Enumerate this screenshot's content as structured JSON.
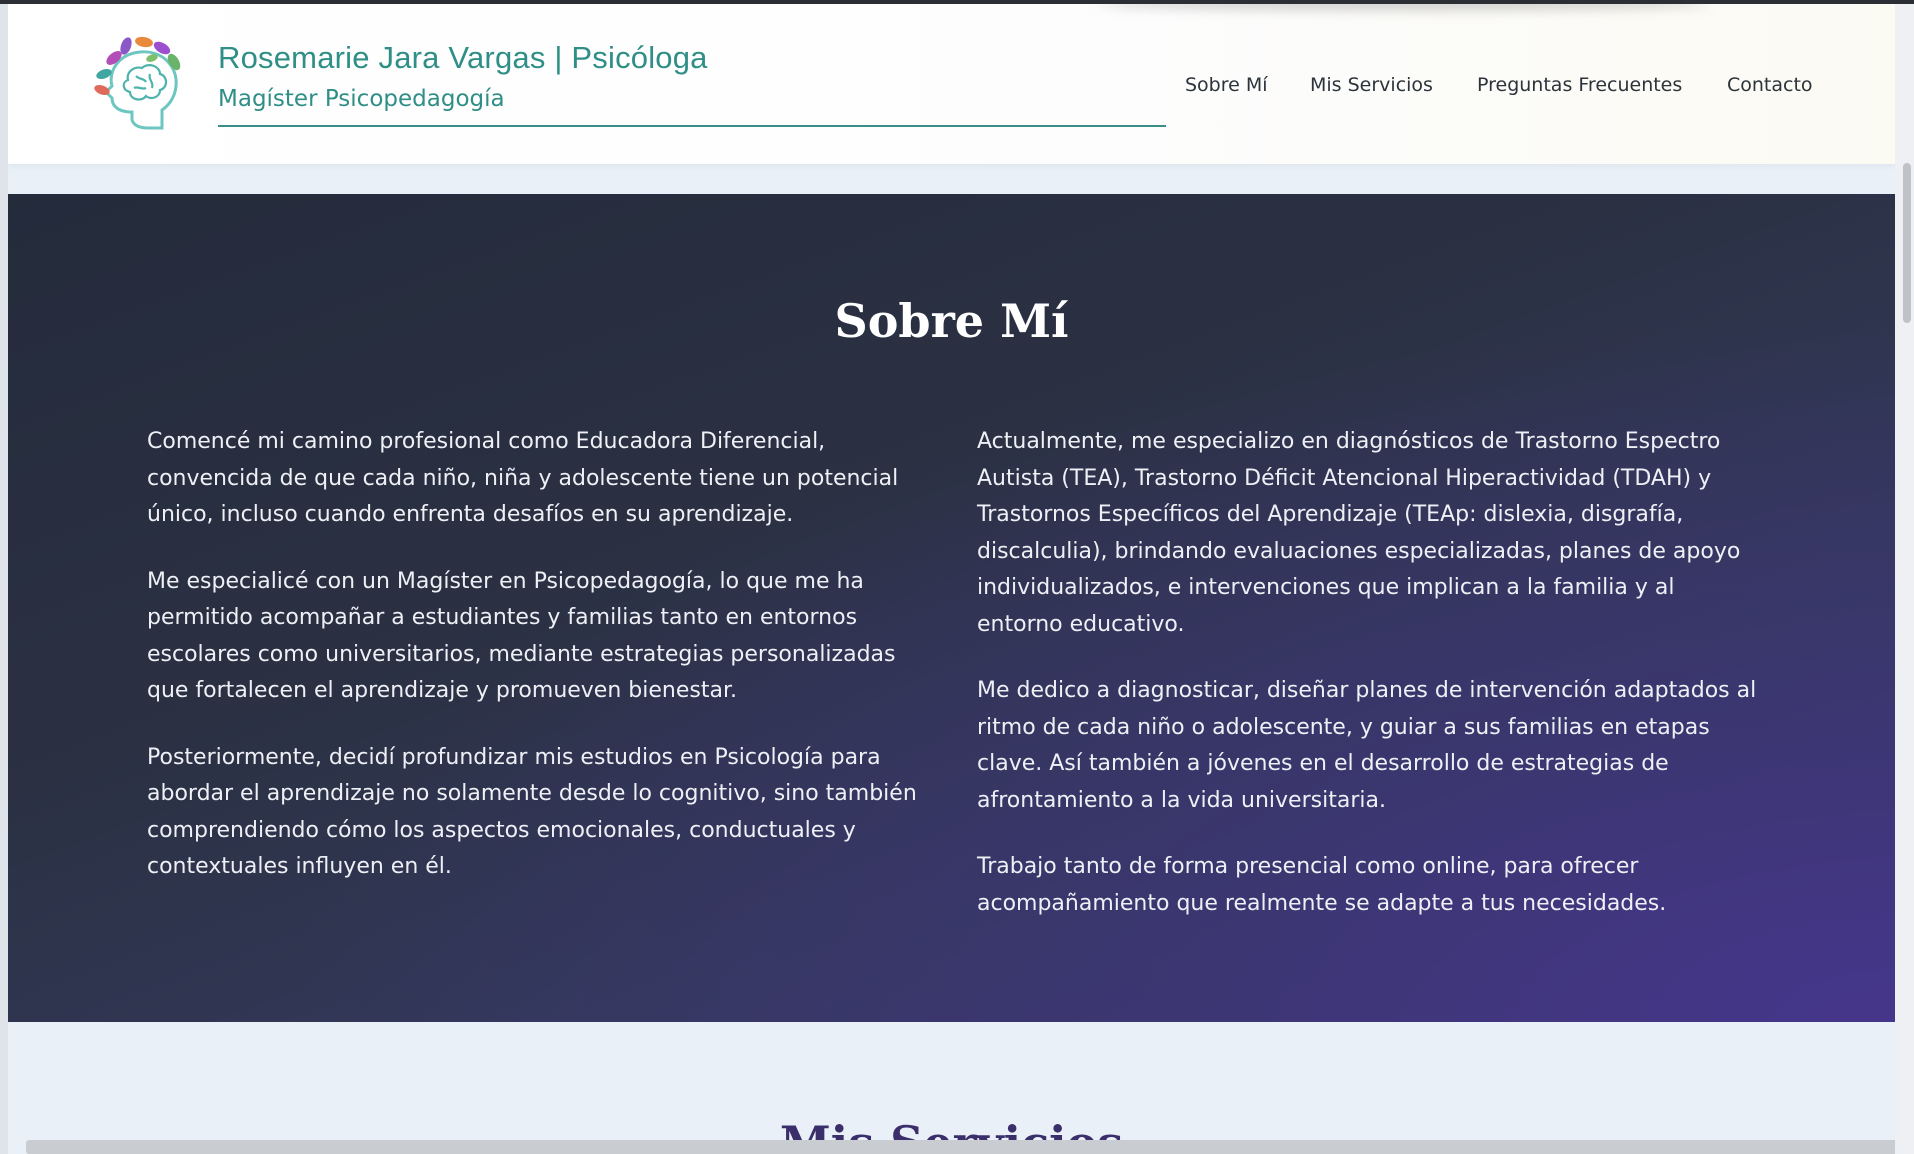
{
  "header": {
    "brand_title": "Rosemarie Jara Vargas | Psicóloga",
    "brand_subtitle": "Magíster Psicopedagogía",
    "logo_icon": "brain-leaves-logo-icon",
    "nav": [
      "Sobre Mí",
      "Mis Servicios",
      "Preguntas Frecuentes",
      "Contacto"
    ]
  },
  "about": {
    "title": "Sobre Mí",
    "left_paragraphs": [
      "Comencé mi camino profesional como Educadora Diferencial, convencida de que cada niño, niña y adolescente tiene un potencial único, incluso cuando enfrenta desafíos en su aprendizaje.",
      "Me especialicé con un Magíster en Psicopedagogía, lo que me ha permitido acompañar a estudiantes y familias tanto en entornos escolares como universitarios, mediante estrategias personalizadas que fortalecen el aprendizaje y promueven bienestar.",
      "Posteriormente, decidí profundizar mis estudios en Psicología para abordar el aprendizaje no solamente desde lo cognitivo, sino también comprendiendo cómo los aspectos emocionales, conductuales y contextuales influyen en él."
    ],
    "right_paragraphs": [
      "Actualmente, me especializo en diagnósticos de Trastorno Espectro Autista (TEA), Trastorno Déficit Atencional Hiperactividad (TDAH) y Trastornos Específicos del Aprendizaje (TEAp: dislexia, disgrafía, discalculia), brindando evaluaciones especializadas, planes de apoyo individualizados, e intervenciones que implican a la familia y al entorno educativo.",
      "Me dedico a diagnosticar, diseñar planes de intervención adaptados al ritmo de cada niño o adolescente, y guiar a sus familias en etapas clave. Así también a jóvenes en el desarrollo de estrategias de afrontamiento a la vida universitaria.",
      "Trabajo tanto de forma presencial como online, para ofrecer acompañamiento que realmente se adapte a tus necesidades."
    ]
  },
  "services": {
    "title": "Mis Servicios"
  },
  "colors": {
    "accent": "#2f8f87",
    "hero_dark": "#242b3b",
    "hero_purple": "#3d3774",
    "heading_purple": "#3a2f6b"
  }
}
